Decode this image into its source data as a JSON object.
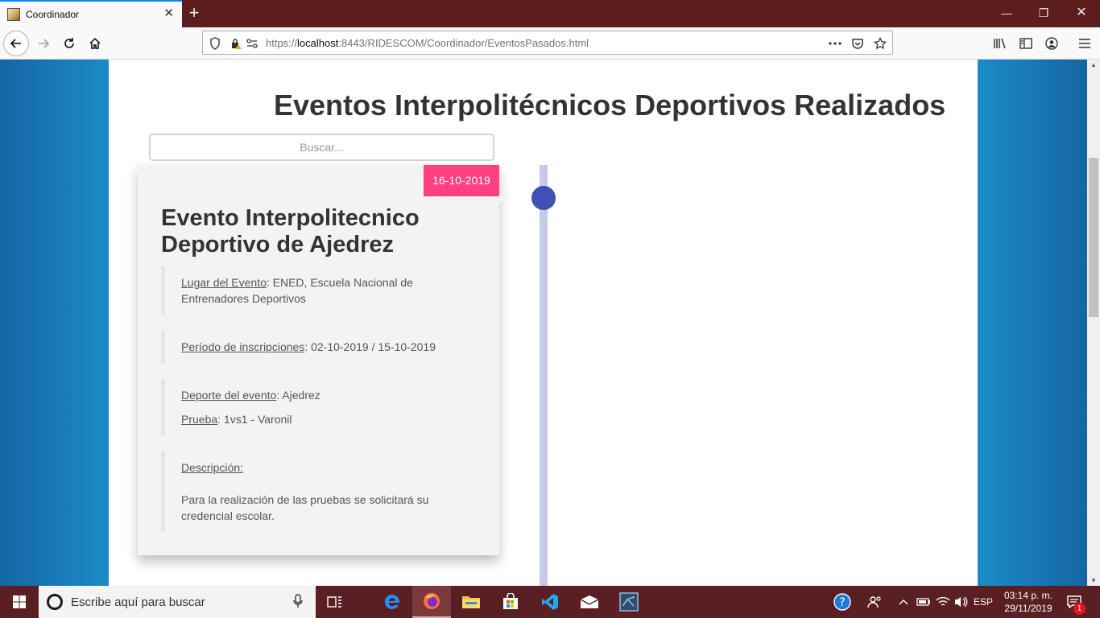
{
  "browser": {
    "tab_title": "Coordinador",
    "tab_close": "✕",
    "new_tab": "+",
    "url_prefix": "https://",
    "url_host": "localhost",
    "url_rest": ":8443/RIDESCOM/Coordinador/EventosPasados.html",
    "window": {
      "minimize": "—",
      "maximize": "❐",
      "close": "✕"
    },
    "icons": [
      "back-icon",
      "forward-icon",
      "reload-icon",
      "home-icon",
      "shield-icon",
      "lock-icon",
      "permissions-icon",
      "more-icon",
      "pocket-icon",
      "bookmark-star-icon",
      "library-icon",
      "sidebar-icon",
      "account-icon",
      "menu-icon"
    ]
  },
  "page": {
    "title": "Eventos Interpolitécnicos Deportivos Realizados",
    "search_placeholder": "Buscar..."
  },
  "event": {
    "date": "16-10-2019",
    "title": "Evento Interpolitecnico Deportivo de Ajedrez",
    "place_label": "Lugar del Evento",
    "place_value": ": ENED, Escuela Nacional de Entrenadores Deportivos",
    "registration_label": "Período de inscripciones",
    "registration_value": ": 02-10-2019 / 15-10-2019",
    "sport_label": "Deporte del evento",
    "sport_value": ": Ajedrez",
    "test_label": "Prueba",
    "test_value": ": 1vs1 - Varonil",
    "description_label": "Descripción:",
    "description_text": "Para la realización de las pruebas se solicitará su credencial escolar."
  },
  "colors": {
    "date_badge": "#ff4081",
    "timeline_dot": "#3f51b5",
    "timeline_line": "#c5cae9",
    "tabbar": "#5c1d1f"
  },
  "taskbar": {
    "search_placeholder": "Escribe aquí para buscar",
    "language": "ESP",
    "time": "03:14 p. m.",
    "date": "29/11/2019",
    "notifications": "1"
  }
}
